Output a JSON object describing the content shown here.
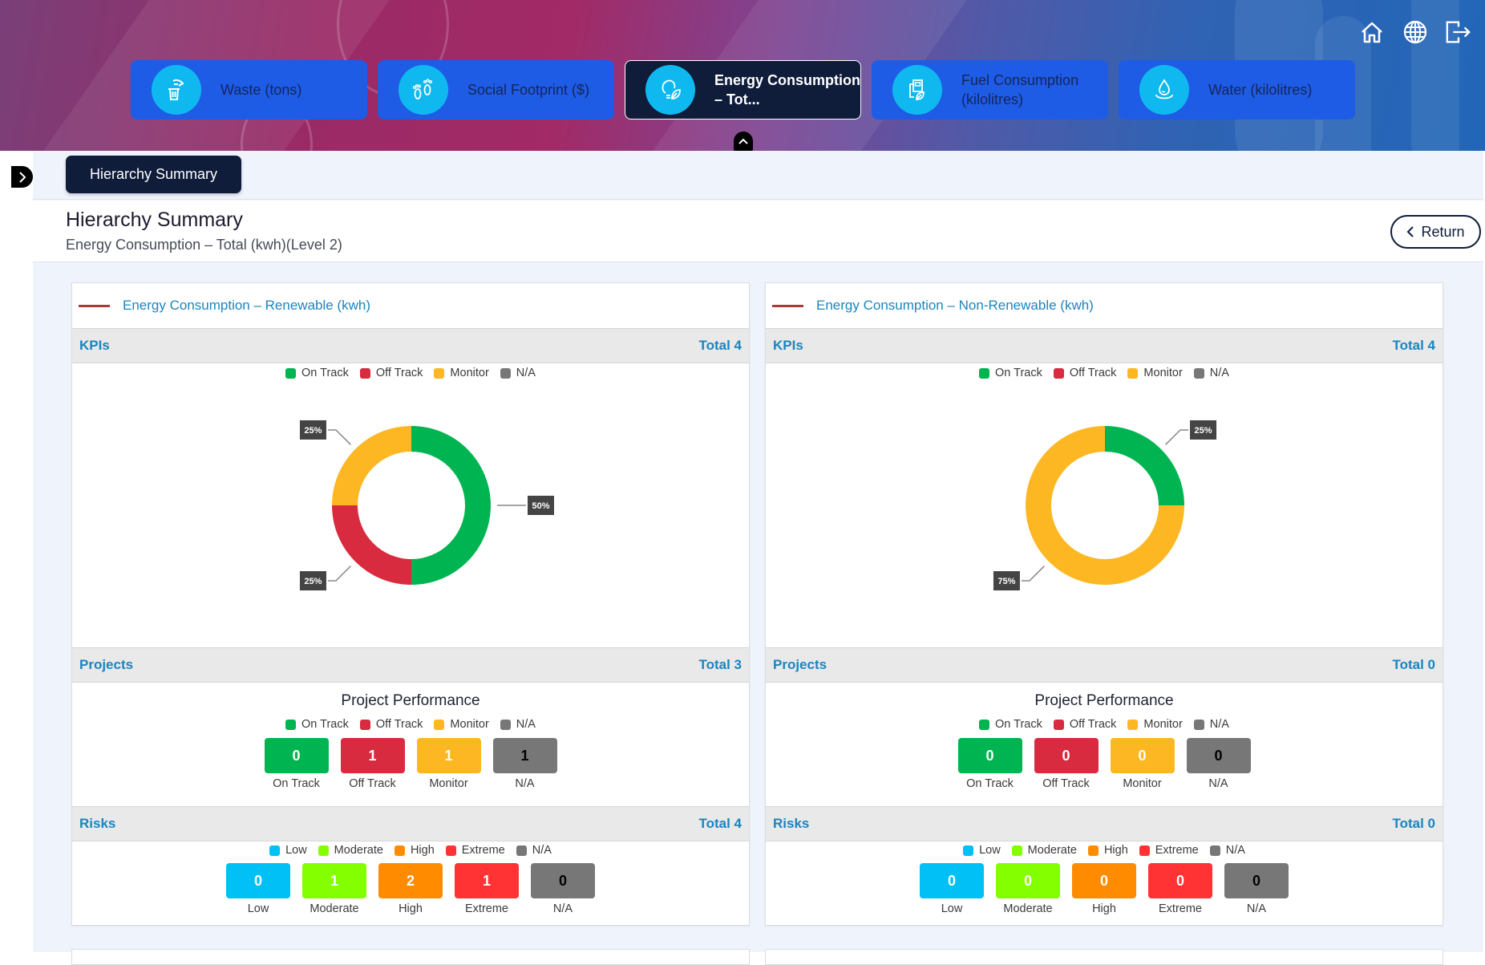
{
  "header": {
    "icons": [
      "home-icon",
      "globe-icon",
      "logout-icon"
    ],
    "tabs": [
      {
        "label": "Waste (tons)",
        "icon": "waste-bin-icon",
        "active": false
      },
      {
        "label": "Social Footprint ($)",
        "icon": "footprints-icon",
        "active": false
      },
      {
        "label": "Energy Consumption – Tot...",
        "icon": "energy-bulb-icon",
        "active": true
      },
      {
        "label": "Fuel Consumption (kilolitres)",
        "icon": "fuel-pump-icon",
        "active": false
      },
      {
        "label": "Water (kilolitres)",
        "icon": "water-drop-icon",
        "active": false
      }
    ]
  },
  "subnav": {
    "button_label": "Hierarchy Summary"
  },
  "page": {
    "title": "Hierarchy Summary",
    "subtitle": "Energy Consumption – Total (kwh)(Level 2)",
    "return_label": "Return"
  },
  "colors": {
    "on_track": "#00b551",
    "off_track": "#d92b3f",
    "monitor": "#fdb723",
    "na": "#777777",
    "low": "#00c0f5",
    "moderate": "#84ff00",
    "high": "#ff8c00",
    "extreme": "#ff3333",
    "accent_text": "#1a85bf",
    "nav_dark": "#0f1c3a",
    "tab_blue": "#1e5ce6"
  },
  "kpi_legend": [
    "On Track",
    "Off Track",
    "Monitor",
    "N/A"
  ],
  "risk_legend": [
    "Low",
    "Moderate",
    "High",
    "Extreme",
    "N/A"
  ],
  "panels": [
    {
      "title": "Energy Consumption – Renewable (kwh)",
      "kpis": {
        "label": "KPIs",
        "total": "Total 4"
      },
      "projects": {
        "label": "Projects",
        "total": "Total 3",
        "chart_title": "Project Performance",
        "values": [
          {
            "label": "On Track",
            "value": "0"
          },
          {
            "label": "Off Track",
            "value": "1"
          },
          {
            "label": "Monitor",
            "value": "1"
          },
          {
            "label": "N/A",
            "value": "1"
          }
        ]
      },
      "risks": {
        "label": "Risks",
        "total": "Total 4",
        "values": [
          {
            "label": "Low",
            "value": "0"
          },
          {
            "label": "Moderate",
            "value": "1"
          },
          {
            "label": "High",
            "value": "2"
          },
          {
            "label": "Extreme",
            "value": "1"
          },
          {
            "label": "N/A",
            "value": "0"
          }
        ]
      }
    },
    {
      "title": "Energy Consumption – Non-Renewable (kwh)",
      "kpis": {
        "label": "KPIs",
        "total": "Total 4"
      },
      "projects": {
        "label": "Projects",
        "total": "Total 0",
        "chart_title": "Project Performance",
        "values": [
          {
            "label": "On Track",
            "value": "0"
          },
          {
            "label": "Off Track",
            "value": "0"
          },
          {
            "label": "Monitor",
            "value": "0"
          },
          {
            "label": "N/A",
            "value": "0"
          }
        ]
      },
      "risks": {
        "label": "Risks",
        "total": "Total 0",
        "values": [
          {
            "label": "Low",
            "value": "0"
          },
          {
            "label": "Moderate",
            "value": "0"
          },
          {
            "label": "High",
            "value": "0"
          },
          {
            "label": "Extreme",
            "value": "0"
          },
          {
            "label": "N/A",
            "value": "0"
          }
        ]
      }
    }
  ],
  "chart_data": [
    {
      "type": "pie",
      "title": "Energy Consumption – Renewable (kwh) KPIs",
      "donut": true,
      "categories": [
        "On Track",
        "Off Track",
        "Monitor",
        "N/A"
      ],
      "values": [
        50,
        25,
        25,
        0
      ],
      "labels": [
        "50%",
        "25%",
        "25%",
        ""
      ],
      "colors": [
        "#00b551",
        "#d92b3f",
        "#fdb723",
        "#777777"
      ],
      "legend": "top"
    },
    {
      "type": "pie",
      "title": "Energy Consumption – Non-Renewable (kwh) KPIs",
      "donut": true,
      "categories": [
        "On Track",
        "Off Track",
        "Monitor",
        "N/A"
      ],
      "values": [
        25,
        0,
        75,
        0
      ],
      "labels": [
        "25%",
        "",
        "75%",
        ""
      ],
      "colors": [
        "#00b551",
        "#d92b3f",
        "#fdb723",
        "#777777"
      ],
      "legend": "top"
    }
  ]
}
